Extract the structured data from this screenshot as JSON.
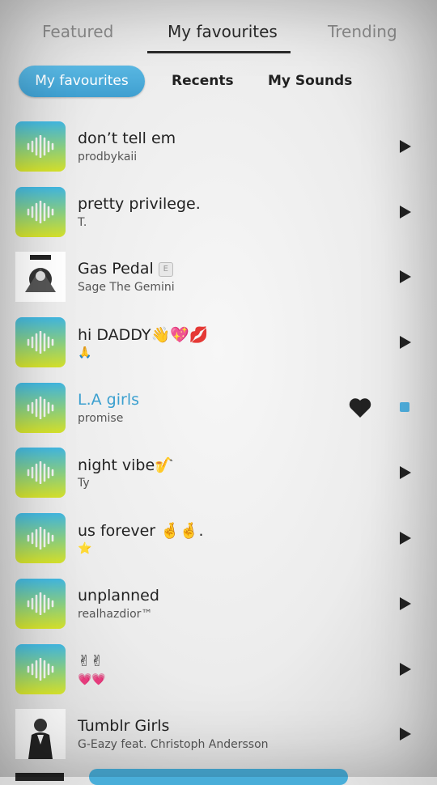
{
  "tabs": [
    "Featured",
    "My favourites",
    "Trending"
  ],
  "segments": [
    "My favourites",
    "Recents",
    "My Sounds"
  ],
  "songs": [
    {
      "title": "don’t tell em",
      "artist": "prodbykaii",
      "thumb": "sound-wave-icon",
      "state": "play"
    },
    {
      "title": "pretty privilege.",
      "artist": "T.",
      "thumb": "sound-wave-icon",
      "state": "play"
    },
    {
      "title": "Gas Pedal",
      "badge": "E",
      "artist": "Sage The Gemini",
      "thumb": "album-art",
      "state": "play"
    },
    {
      "title": "hi DADDY👋💖💋",
      "artist": "🙏",
      "thumb": "sound-wave-icon",
      "state": "play"
    },
    {
      "title": "L.A girls",
      "artist": "promise",
      "thumb": "sound-wave-icon",
      "state": "playing"
    },
    {
      "title": "night vibe🎷",
      "artist": "Ty",
      "thumb": "sound-wave-icon",
      "state": "play"
    },
    {
      "title": "us forever 🤞🤞.",
      "artist": "⭐",
      "thumb": "sound-wave-icon",
      "state": "play"
    },
    {
      "title": "unplanned",
      "artist": "realhazdior™",
      "thumb": "sound-wave-icon",
      "state": "play"
    },
    {
      "title": "✌✌",
      "artist": "💗💗",
      "thumb": "sound-wave-icon",
      "state": "play"
    },
    {
      "title": "Tumblr Girls",
      "artist": "G-Eazy feat. Christoph Andersson",
      "thumb": "album-art",
      "state": "play"
    }
  ],
  "colors": {
    "accent": "#3a9fcf",
    "text": "#222222",
    "inactive_tab": "#8a8a8a"
  }
}
